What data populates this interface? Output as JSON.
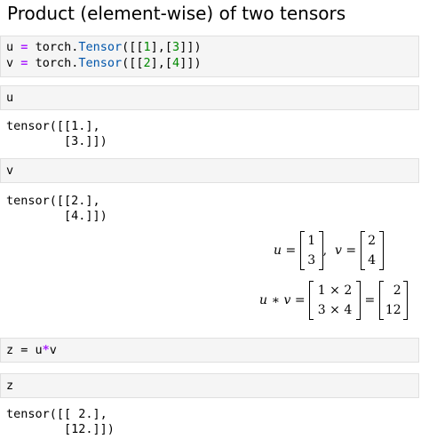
{
  "heading": "Product (element-wise) of two tensors",
  "cells": {
    "c1": {
      "line1": {
        "var": "u",
        "eq": "=",
        "mod": "torch.",
        "cls": "Tensor",
        "open": "([[",
        "n1": "1",
        "mid": "],[",
        "n2": "3",
        "close": "]])"
      },
      "line2": {
        "var": "v",
        "eq": "=",
        "mod": "torch.",
        "cls": "Tensor",
        "open": "([[",
        "n1": "2",
        "mid": "],[",
        "n2": "4",
        "close": "]])"
      }
    },
    "c2": {
      "code": "u",
      "output": "tensor([[1.],\n        [3.]])"
    },
    "c3": {
      "code": "v",
      "output": "tensor([[2.],\n        [4.]])"
    },
    "c4": {
      "code_a": "z = u",
      "code_op": "*",
      "code_b": "v"
    },
    "c5": {
      "code": "z",
      "output": "tensor([[ 2.],\n        [12.]])"
    }
  },
  "math": {
    "line1": {
      "u": "u",
      "eq": "=",
      "u_vals": [
        "1",
        "3"
      ],
      "sep": ",",
      "v": "v",
      "eq2": "=",
      "v_vals": [
        "2",
        "4"
      ]
    },
    "line2": {
      "lhs_u": "u",
      "star": "∗",
      "lhs_v": "v",
      "eq": "=",
      "mid_vals": [
        "1 × 2",
        "3 × 4"
      ],
      "eq2": "=",
      "res_vals": [
        "2",
        "12"
      ]
    }
  }
}
